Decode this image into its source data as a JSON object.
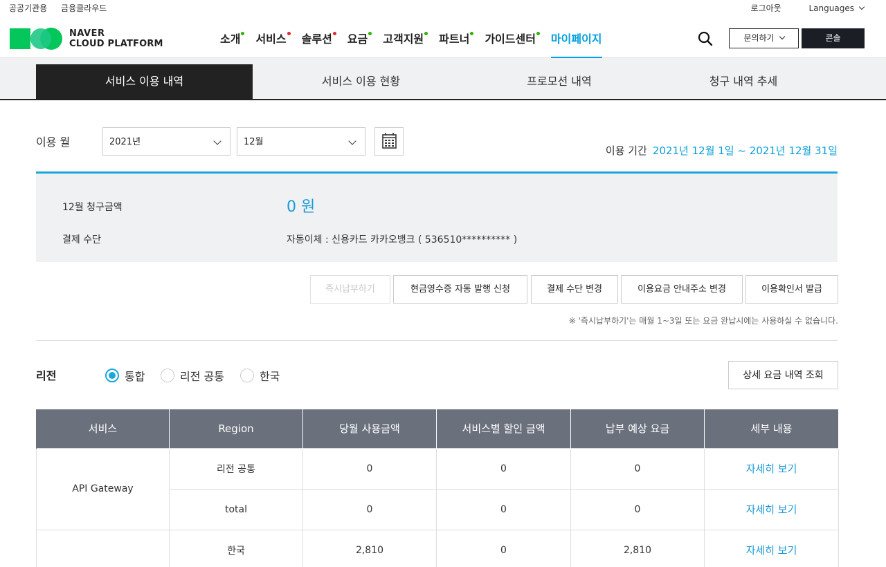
{
  "util": {
    "left_links": [
      "공공기관용",
      "금융클라우드"
    ],
    "logout": "로그아웃",
    "languages": "Languages"
  },
  "header": {
    "logo_line1": "NAVER",
    "logo_line2": "CLOUD PLATFORM",
    "menu": [
      {
        "label": "소개",
        "dot": "#2db400"
      },
      {
        "label": "서비스",
        "dot": "#e0272c"
      },
      {
        "label": "솔루션",
        "dot": "#e0272c"
      },
      {
        "label": "요금",
        "dot": "#2db400"
      },
      {
        "label": "고객지원",
        "dot": "#2db400"
      },
      {
        "label": "파트너",
        "dot": "#2db400"
      },
      {
        "label": "가이드센터",
        "dot": "#2db400"
      },
      {
        "label": "마이페이지",
        "dot": ""
      }
    ],
    "inquiry": "문의하기",
    "console": "콘솔"
  },
  "tabs": [
    "서비스 이용 내역",
    "서비스 이용 현황",
    "프로모션 내역",
    "청구 내역 추세"
  ],
  "usage": {
    "label": "이용 월",
    "year": "2021년",
    "month": "12월",
    "period_label": "이용 기간",
    "period_value": "2021년 12월 1일 ~ 2021년 12월 31일"
  },
  "summary": {
    "bill_label": "12월 청구금액",
    "bill_value": "0 원",
    "payment_label": "결제 수단",
    "payment_value": "자동이체 : 신용카드 카카오뱅크 ( 536510********** )"
  },
  "actions": [
    "즉시납부하기",
    "현금영수증 자동 발행 신청",
    "결제 수단 변경",
    "이용요금 안내주소 변경",
    "이용확인서 발급"
  ],
  "note": "※ '즉시납부하기'는 매월 1~3일 또는 요금 완납시에는 사용하실 수 없습니다.",
  "region": {
    "label": "리전",
    "options": [
      "통합",
      "리전 공통",
      "한국"
    ],
    "selected": "통합",
    "detail_button": "상세 요금 내역 조회"
  },
  "table": {
    "headers": [
      "서비스",
      "Region",
      "당월 사용금액",
      "서비스별 할인 금액",
      "납부 예상 요금",
      "세부 내용"
    ],
    "rows": [
      {
        "service": "API Gateway",
        "region": "리전 공통",
        "usage": "0",
        "discount": "0",
        "expected": "0",
        "detail": "자세히 보기"
      },
      {
        "service": "",
        "region": "total",
        "usage": "0",
        "discount": "0",
        "expected": "0",
        "detail": "자세히 보기"
      },
      {
        "service": "",
        "region": "한국",
        "usage": "2,810",
        "discount": "0",
        "expected": "2,810",
        "detail": "자세히 보기"
      }
    ]
  }
}
